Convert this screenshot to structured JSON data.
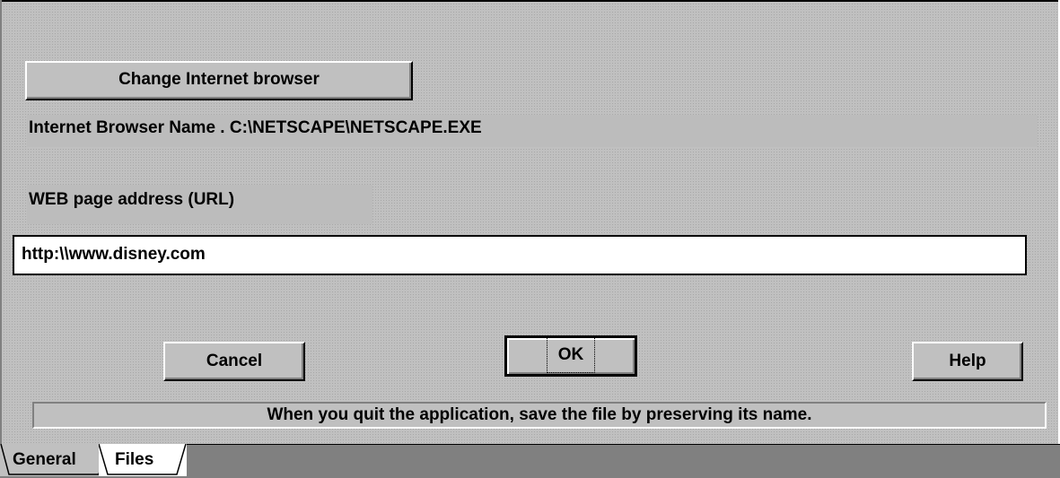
{
  "buttons": {
    "change_browser": "Change Internet browser",
    "cancel": "Cancel",
    "ok": "OK",
    "help": "Help"
  },
  "browser": {
    "label": "Internet Browser Name . C:\\NETSCAPE\\NETSCAPE.EXE"
  },
  "url": {
    "label": "WEB page address (URL)",
    "value": "http:\\\\www.disney.com"
  },
  "status": {
    "text": "When you quit the application, save the file by preserving its name."
  },
  "tabs": [
    {
      "label": "General",
      "active": false
    },
    {
      "label": "Files",
      "active": true
    }
  ]
}
